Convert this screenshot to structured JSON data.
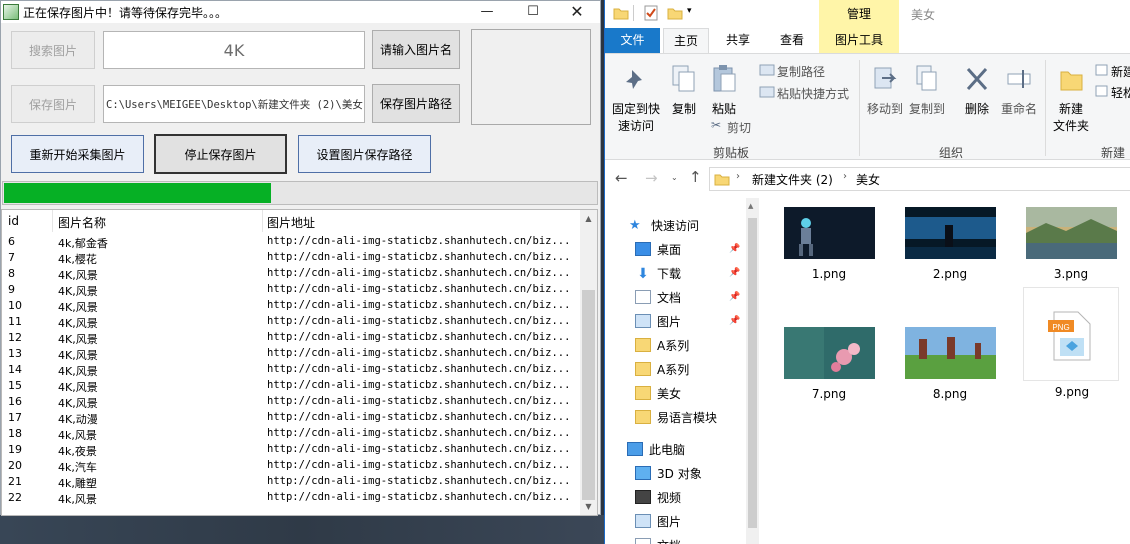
{
  "app": {
    "title": "正在保存图片中！请等待保存完毕。。。",
    "buttons": {
      "search": "搜索图片",
      "save": "保存图片",
      "input_name": "请输入图片名",
      "save_path": "保存图片路径",
      "restart": "重新开始采集图片",
      "stop": "停止保存图片",
      "set_path": "设置图片保存路径"
    },
    "fields": {
      "keyword": "4K",
      "path": "C:\\Users\\MEIGEE\\Desktop\\新建文件夹 (2)\\美女"
    },
    "progress": 0.45,
    "table": {
      "headers": [
        "id",
        "图片名称",
        "图片地址"
      ],
      "rows": [
        [
          "6",
          "4k,郁金香",
          "http://cdn-ali-img-staticbz.shanhutech.cn/biz..."
        ],
        [
          "7",
          "4k,樱花",
          "http://cdn-ali-img-staticbz.shanhutech.cn/biz..."
        ],
        [
          "8",
          "4K,风景",
          "http://cdn-ali-img-staticbz.shanhutech.cn/biz..."
        ],
        [
          "9",
          "4K,风景",
          "http://cdn-ali-img-staticbz.shanhutech.cn/biz..."
        ],
        [
          "10",
          "4K,风景",
          "http://cdn-ali-img-staticbz.shanhutech.cn/biz..."
        ],
        [
          "11",
          "4K,风景",
          "http://cdn-ali-img-staticbz.shanhutech.cn/biz..."
        ],
        [
          "12",
          "4K,风景",
          "http://cdn-ali-img-staticbz.shanhutech.cn/biz..."
        ],
        [
          "13",
          "4K,风景",
          "http://cdn-ali-img-staticbz.shanhutech.cn/biz..."
        ],
        [
          "14",
          "4K,风景",
          "http://cdn-ali-img-staticbz.shanhutech.cn/biz..."
        ],
        [
          "15",
          "4K,风景",
          "http://cdn-ali-img-staticbz.shanhutech.cn/biz..."
        ],
        [
          "16",
          "4K,风景",
          "http://cdn-ali-img-staticbz.shanhutech.cn/biz..."
        ],
        [
          "17",
          "4K,动漫",
          "http://cdn-ali-img-staticbz.shanhutech.cn/biz..."
        ],
        [
          "18",
          "4k,风景",
          "http://cdn-ali-img-staticbz.shanhutech.cn/biz..."
        ],
        [
          "19",
          "4k,夜景",
          "http://cdn-ali-img-staticbz.shanhutech.cn/biz..."
        ],
        [
          "20",
          "4k,汽车",
          "http://cdn-ali-img-staticbz.shanhutech.cn/biz..."
        ],
        [
          "21",
          "4k,雕塑",
          "http://cdn-ali-img-staticbz.shanhutech.cn/biz..."
        ],
        [
          "22",
          "4k,风景",
          "http://cdn-ali-img-staticbz.shanhutech.cn/biz..."
        ]
      ]
    }
  },
  "explorer": {
    "context_tab": "管理",
    "window_title": "美女",
    "tabs": [
      "文件",
      "主页",
      "共享",
      "查看",
      "图片工具"
    ],
    "ribbon": {
      "pin": "固定到快速访问",
      "pin_l1": "固定到快",
      "pin_l2": "速访问",
      "copy": "复制",
      "paste": "粘贴",
      "copy_path": "复制路径",
      "paste_shortcut": "粘贴快捷方式",
      "cut": "剪切",
      "clipboard": "剪贴板",
      "move_to": "移动到",
      "copy_to": "复制到",
      "delete": "删除",
      "rename": "重命名",
      "organize": "组织",
      "new_folder_l1": "新建",
      "new_folder_l2": "文件夹",
      "new_item": "新建",
      "easy_access": "轻松",
      "new_group": "新建"
    },
    "breadcrumb": [
      "新建文件夹 (2)",
      "美女"
    ],
    "nav": {
      "quick_access": "快速访问",
      "items": [
        "桌面",
        "下载",
        "文档",
        "图片",
        "A系列",
        "A系列",
        "美女",
        "易语言模块"
      ],
      "this_pc": "此电脑",
      "pc_items": [
        "3D 对象",
        "视频",
        "图片",
        "文档"
      ]
    },
    "files": [
      "1.png",
      "2.png",
      "3.png",
      "7.png",
      "8.png",
      "9.png"
    ],
    "colors": {
      "accent": "#1979ca",
      "context": "#fff5a8",
      "progress": "#06b025"
    }
  }
}
